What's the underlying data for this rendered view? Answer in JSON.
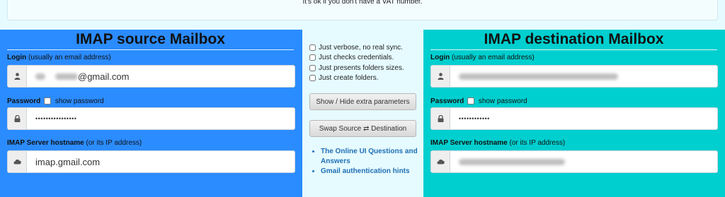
{
  "notice": {
    "text": "It's ok if you don't have a VAT number."
  },
  "source": {
    "title": "IMAP source Mailbox",
    "login_label": "Login",
    "login_hint": "(usually an email address)",
    "login_value": "@gmail.com",
    "password_label": "Password",
    "show_password_label": "show password",
    "password_mask": "••••••••••••••••",
    "host_label": "IMAP Server hostname",
    "host_hint": "(or its IP address)",
    "host_value": "imap.gmail.com"
  },
  "middle": {
    "options": [
      "Just verbose, no real sync.",
      "Just checks credentials.",
      "Just presents folders sizes.",
      "Just create folders."
    ],
    "extra_params_button": "Show / Hide extra parameters",
    "swap_button": "Swap Source ⇄ Destination",
    "links": [
      "The Online UI Questions and Answers",
      "Gmail authentication hints"
    ]
  },
  "dest": {
    "title": "IMAP destination Mailbox",
    "login_label": "Login",
    "login_hint": "(usually an email address)",
    "password_label": "Password",
    "show_password_label": "show password",
    "password_mask": "••••••••••••",
    "host_label": "IMAP Server hostname",
    "host_hint": "(or its IP address)"
  },
  "icons": {
    "user": "user-icon",
    "lock": "lock-icon",
    "cloud": "cloud-icon"
  }
}
